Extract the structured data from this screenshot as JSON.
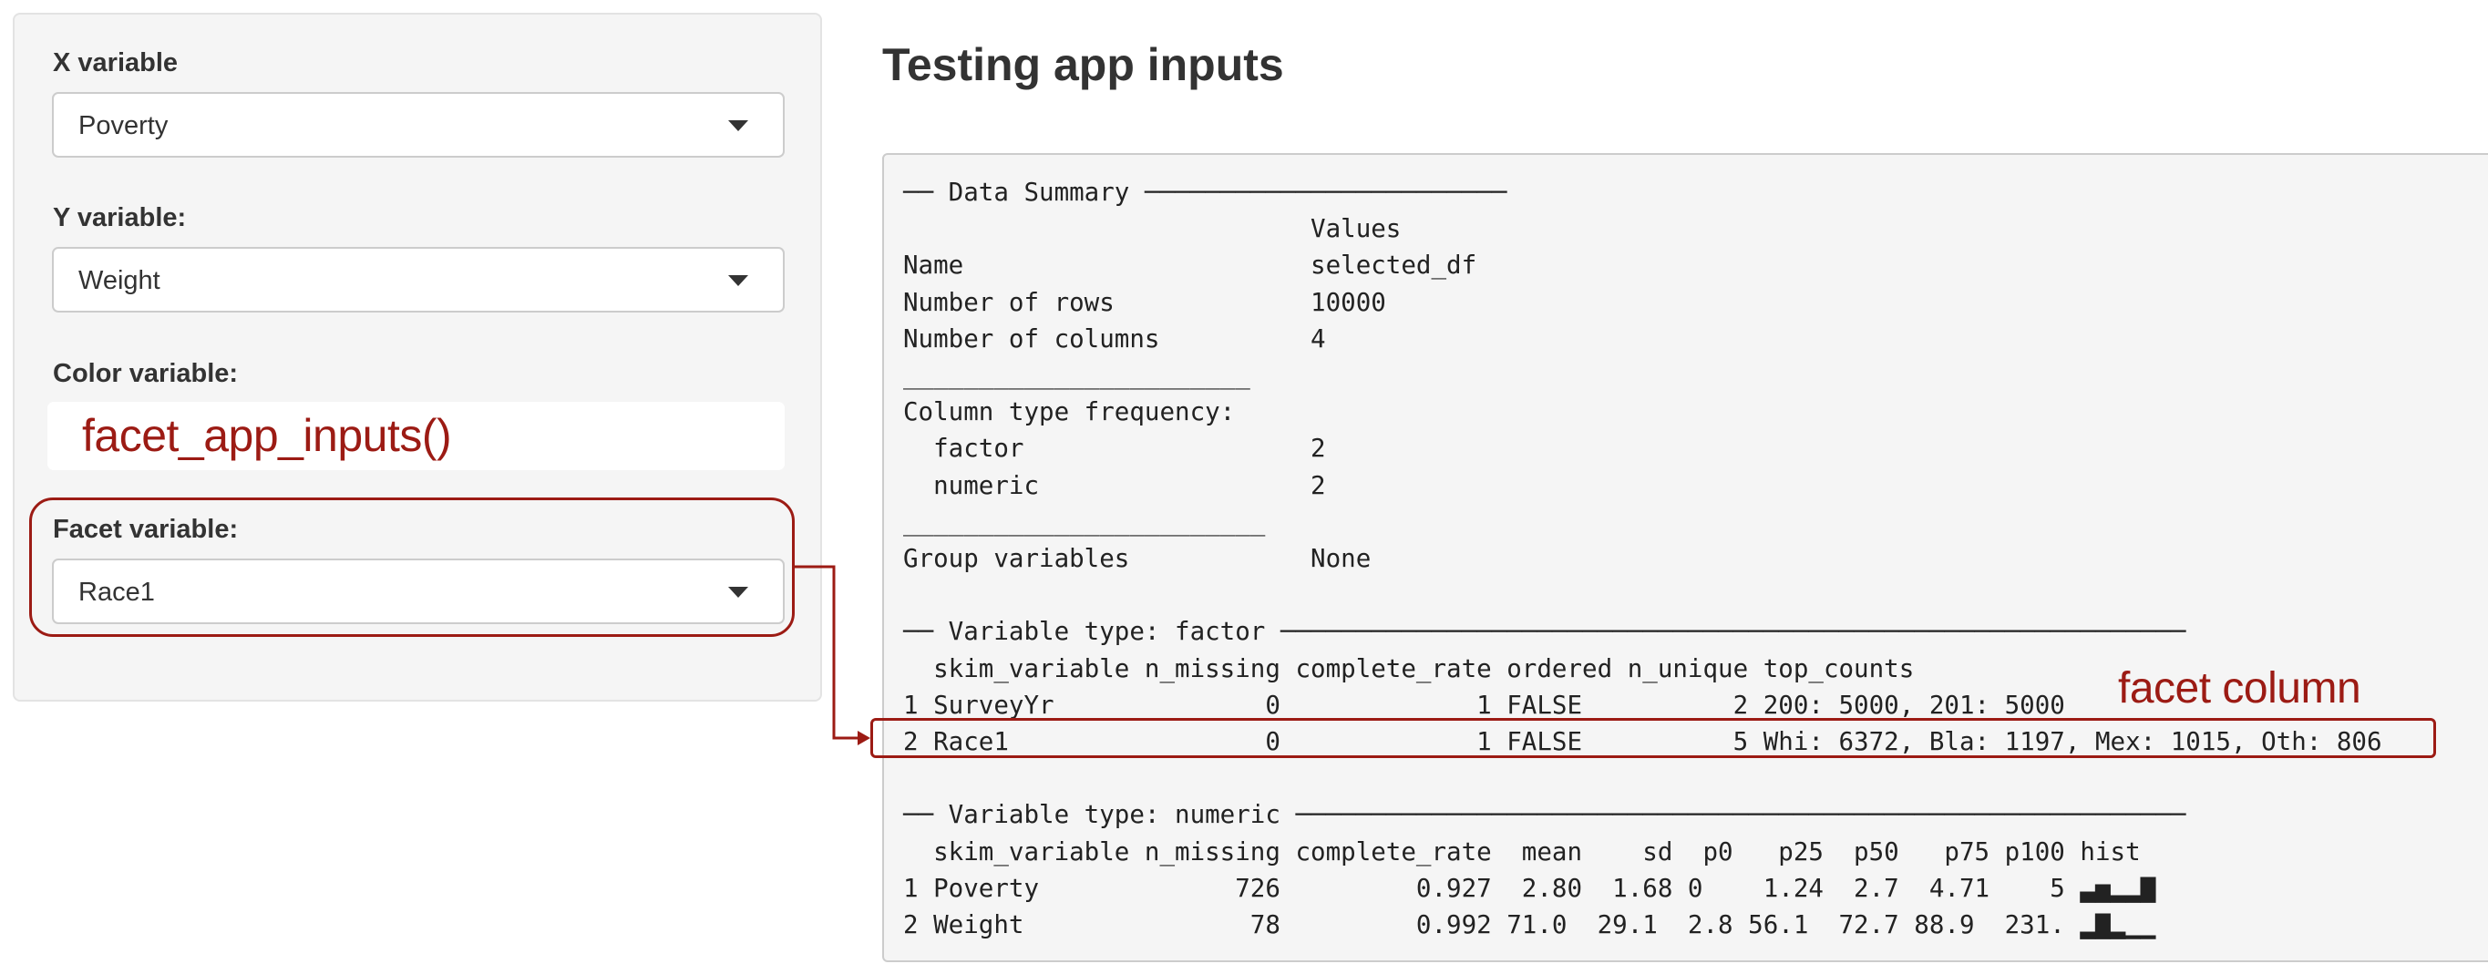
{
  "sidebar": {
    "x_variable": {
      "label": "X variable",
      "value": "Poverty"
    },
    "y_variable": {
      "label": "Y variable:",
      "value": "Weight"
    },
    "color_variable": {
      "label": "Color variable:",
      "value": ""
    },
    "facet_variable": {
      "label": "Facet variable:",
      "value": "Race1"
    }
  },
  "annotations": {
    "function_label": "facet_app_inputs()",
    "column_label": "facet column",
    "color": "#9c1b14"
  },
  "main": {
    "title": "Testing app inputs",
    "console_lines": [
      "── Data Summary ────────────────────────",
      "                           Values",
      "Name                       selected_df",
      "Number of rows             10000",
      "Number of columns          4",
      "_______________________",
      "Column type frequency:",
      "  factor                   2",
      "  numeric                  2",
      "________________________",
      "Group variables            None",
      "",
      "── Variable type: factor ────────────────────────────────────────────────────────────",
      "  skim_variable n_missing complete_rate ordered n_unique top_counts",
      "1 SurveyYr              0             1 FALSE          2 200: 5000, 201: 5000",
      "2 Race1                 0             1 FALSE          5 Whi: 6372, Bla: 1197, Mex: 1015, Oth: 806",
      "",
      "── Variable type: numeric ───────────────────────────────────────────────────────────",
      "  skim_variable n_missing complete_rate  mean    sd  p0   p25  p50   p75 p100 hist",
      "1 Poverty             726         0.927  2.80  1.68 0    1.24  2.7  4.71    5 ▃▅▂▂▇",
      "2 Weight               78         0.992 71.0  29.1  2.8 56.1  72.7 88.9  231. ▂▇▂▁▁"
    ]
  }
}
